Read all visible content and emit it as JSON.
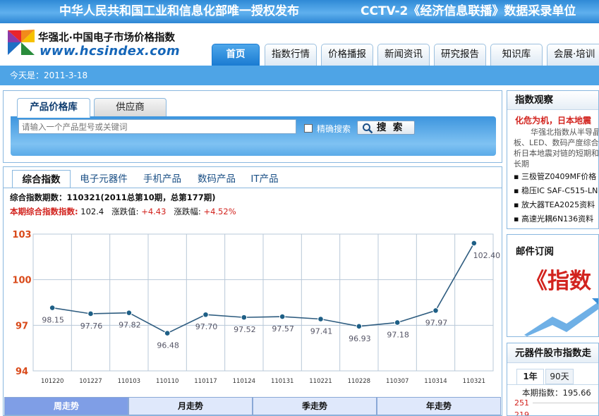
{
  "banner": {
    "left": "中华人民共和国工业和信息化部唯一授权发布",
    "right": "CCTV-2《经济信息联播》数据采录单位"
  },
  "brand": {
    "name_cn": "华强北·中国电子市场价格指数",
    "url": "www.hcsindex.com"
  },
  "nav": {
    "tabs": [
      "首页",
      "指数行情",
      "价格播报",
      "新闻资讯",
      "研究报告",
      "知识库",
      "会展·培训"
    ],
    "active": "首页"
  },
  "datebar": {
    "text": "今天是：2011-3-18"
  },
  "search": {
    "tabs": [
      "产品价格库",
      "供应商"
    ],
    "placeholder": "请输入一个产品型号或关键词",
    "exact_label": "精确搜索",
    "button_label": "搜  索"
  },
  "chart_tabs": [
    "综合指数",
    "电子元器件",
    "手机产品",
    "数码产品",
    "IT产品"
  ],
  "index_info": {
    "period_label": "综合指数期数：",
    "period_value": "110321(2011总第10期，总第177期)",
    "current_label": "本期综合指数指数:",
    "current_value": "102.4",
    "change_label": "涨跌值:",
    "change_value": "+4.43",
    "pct_label": "涨跌幅:",
    "pct_value": "+4.52%"
  },
  "chart_data": {
    "type": "line",
    "categories": [
      "101220",
      "101227",
      "110103",
      "110110",
      "110117",
      "110124",
      "110131",
      "110221",
      "110228",
      "110307",
      "110314",
      "110321"
    ],
    "series": [
      {
        "values": [
          98.15,
          97.76,
          97.82,
          96.48,
          97.7,
          97.52,
          97.57,
          97.41,
          96.93,
          97.18,
          97.97,
          102.4
        ]
      }
    ],
    "yticks": [
      "94",
      "97",
      "100",
      "103"
    ],
    "ylim": [
      94,
      103
    ],
    "grid": true,
    "colors": {
      "line": "#2f5d80",
      "marker": "#1e5f86",
      "axis_label": "#d94a1a"
    }
  },
  "trend_tabs": [
    "周走势",
    "月走势",
    "季走势",
    "年走势"
  ],
  "right": {
    "watch": {
      "title": "指数观察",
      "headline": "化危为机，日本地震",
      "summary": "华强北指数从半导晶面板、LED、数码产度综合分析日本地震对链的短期和中长期",
      "items": [
        "三极管Z0409MF价格",
        "稳压IC SAF-C515-LN",
        "放大器TEA2025资料",
        "高速光耦6N136资料"
      ]
    },
    "mail": {
      "title": "邮件订阅",
      "promo": "《指数"
    },
    "stock": {
      "title": "元器件股市指数走",
      "tabs": [
        "1年",
        "90天"
      ],
      "current_label": "本期指数：",
      "current_value": "195.66",
      "axis": [
        "251",
        "219"
      ]
    }
  }
}
